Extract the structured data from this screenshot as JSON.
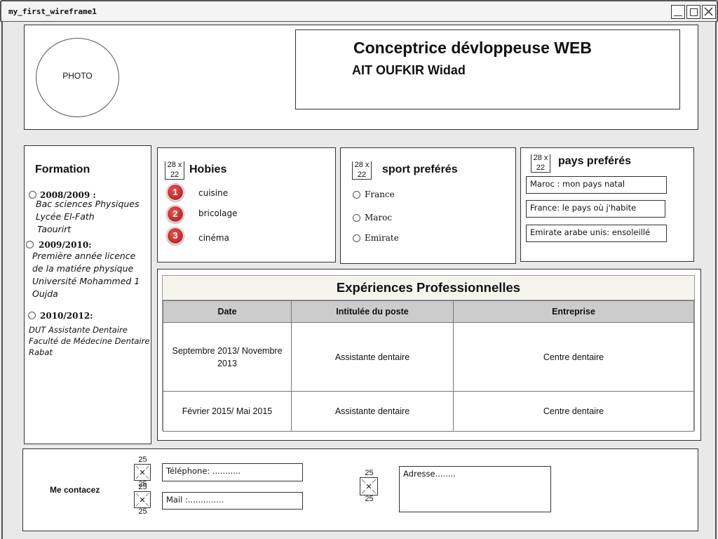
{
  "window": {
    "title": "my_first_wireframe1"
  },
  "header": {
    "photo_label": "PHOTO",
    "job_title": "Conceptrice dévloppeuse WEB",
    "name": "AIT OUFKIR Widad"
  },
  "formation": {
    "title": "Formation",
    "entries": [
      {
        "year": "2008/2009 :",
        "lines": [
          "Bac sciences Physiques",
          "Lycée El-Fath",
          "Taourirt"
        ]
      },
      {
        "year": "2009/2010:",
        "lines": [
          "Première année licence",
          "de la matiére physique",
          "Université Mohammed 1",
          "Oujda"
        ]
      },
      {
        "year": "2010/2012:",
        "lines": [
          "DUT Assistante Dentaire",
          "Faculté de Médecine Dentaire",
          "Rabat"
        ]
      }
    ]
  },
  "image_placeholder": {
    "w": "28 x",
    "h": "22"
  },
  "hobbies": {
    "title": "Hobies",
    "items": [
      {
        "num": "1",
        "label": "cuisine"
      },
      {
        "num": "2",
        "label": "bricolage"
      },
      {
        "num": "3",
        "label": "cinéma"
      }
    ]
  },
  "sports": {
    "title": "sport preférés",
    "options": [
      "France",
      "Maroc",
      "Emirate"
    ]
  },
  "countries": {
    "title": "pays preférés",
    "fields": [
      "Maroc : mon pays natal",
      "France: le pays où j'habite",
      "Emirate arabe unis: ensoleillé"
    ]
  },
  "experience": {
    "title": "Expériences Professionnelles",
    "columns": [
      "Date",
      "Intitulée du poste",
      "Entreprise"
    ],
    "rows": [
      [
        "Septembre 2013/ Novembre 2013",
        "Assistante dentaire",
        "Centre dentaire"
      ],
      [
        "Février 2015/ Mai 2015",
        "Assistante dentaire",
        "Centre dentaire"
      ]
    ]
  },
  "contact": {
    "label": "Me contacez",
    "icon_size": "25",
    "phone": "Téléphone: ...........",
    "mail": "Mail :..............",
    "address": "Adresse........"
  }
}
